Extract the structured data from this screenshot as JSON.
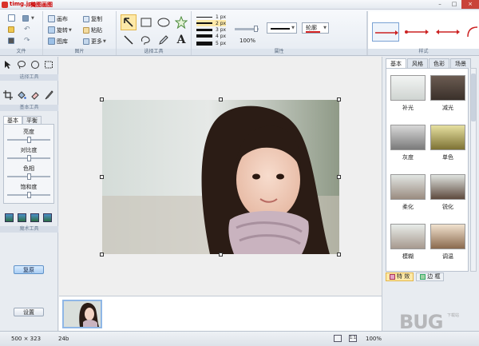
{
  "window": {
    "doc_title": "timg.jpg",
    "app_title": "美图画图",
    "controls": [
      "–",
      "□",
      "×"
    ]
  },
  "ribbon": {
    "file_group": {
      "label": "文件"
    },
    "image_group": {
      "label": "图片",
      "buttons": {
        "canvas": "画布",
        "copy": "复制",
        "rotate": "旋转",
        "paste": "粘贴",
        "library": "图库",
        "more": "更多"
      }
    },
    "shapes_group": {
      "label": "选择工具"
    },
    "props_group": {
      "label": "属性",
      "line_widths": [
        "1 px",
        "2 px",
        "3 px",
        "4 px",
        "5 px"
      ],
      "selected_width": "2 px",
      "opacity": "100%",
      "outline_label": "轮廓"
    },
    "style_group": {
      "label": "样式"
    }
  },
  "left_panel": {
    "select_tools_label": "选择工具",
    "basic_tools_label": "基本工具",
    "adjust_tabs": [
      "基本",
      "平衡"
    ],
    "sliders": [
      {
        "label": "亮度",
        "value": 0.5
      },
      {
        "label": "对比度",
        "value": 0.5
      },
      {
        "label": "色相",
        "value": 0.5
      },
      {
        "label": "饱和度",
        "value": 0.5
      }
    ],
    "magic_tools_label": "魔术工具",
    "restore_button": "复原",
    "settings_button": "设置"
  },
  "right_panel": {
    "tabs": [
      "基本",
      "风格",
      "色彩",
      "场景"
    ],
    "effects": [
      "补光",
      "减光",
      "灰度",
      "单色",
      "柔化",
      "锐化",
      "模糊",
      "调温"
    ],
    "bottom_tabs": [
      "特 效",
      "边 框"
    ]
  },
  "status": {
    "size": "500 × 323",
    "depth": "24b",
    "zoom": "100%"
  },
  "watermark": {
    "text": "BUG",
    "sub": "下载站"
  }
}
